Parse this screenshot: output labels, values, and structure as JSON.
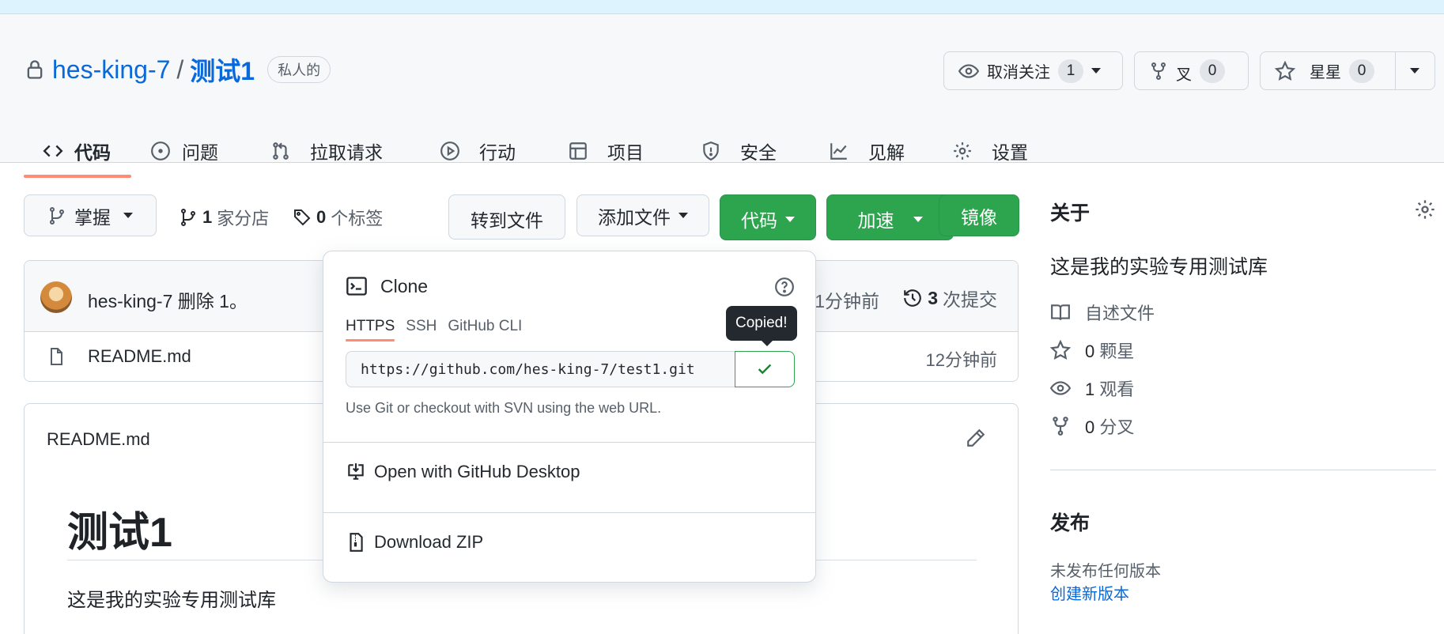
{
  "repo": {
    "owner": "hes-king-7",
    "separator": "/",
    "name": "测试1",
    "visibility": "私人的"
  },
  "header_actions": {
    "watch": {
      "label": "取消关注",
      "count": "1"
    },
    "fork": {
      "label": "叉",
      "count": "0"
    },
    "star": {
      "label": "星星",
      "count": "0"
    }
  },
  "tabs": [
    {
      "label": "代码",
      "icon": "code-icon",
      "active": true
    },
    {
      "label": "问题",
      "icon": "issue-icon"
    },
    {
      "label": "拉取请求",
      "icon": "pull-request-icon"
    },
    {
      "label": "行动",
      "icon": "play-icon"
    },
    {
      "label": "项目",
      "icon": "table-icon"
    },
    {
      "label": "安全",
      "icon": "shield-icon"
    },
    {
      "label": "见解",
      "icon": "graph-icon"
    },
    {
      "label": "设置",
      "icon": "gear-icon"
    }
  ],
  "toolbar": {
    "branch": "掌握",
    "branches_count": "1",
    "branches_label": "家分店",
    "tags_count": "0",
    "tags_label": "个标签",
    "goto_file": "转到文件",
    "add_file": "添加文件",
    "code": "代码",
    "speedup": "加速",
    "mirror": "镜像"
  },
  "commit": {
    "author": "hes-king-7",
    "message": "删除 1。",
    "time": "1分钟前",
    "count": "3",
    "count_label": "次提交"
  },
  "files": [
    {
      "name": "README.md",
      "time": "12分钟前"
    }
  ],
  "readme": {
    "filename": "README.md",
    "heading": "测试1",
    "body": "这是我的实验专用测试库"
  },
  "about": {
    "title": "关于",
    "description": "这是我的实验专用测试库",
    "readme_link": "自述文件",
    "stars_count": "0",
    "stars_label": "颗星",
    "watchers_count": "1",
    "watchers_label": "观看",
    "forks_count": "0",
    "forks_label": "分叉"
  },
  "releases": {
    "title": "发布",
    "empty": "未发布任何版本",
    "create": "创建新版本"
  },
  "clone_popover": {
    "title": "Clone",
    "tabs": [
      "HTTPS",
      "SSH",
      "GitHub CLI"
    ],
    "url": "https://github.com/hes-king-7/test1.git",
    "hint": "Use Git or checkout with SVN using the web URL.",
    "tooltip": "Copied!",
    "open_desktop": "Open with GitHub Desktop",
    "download_zip": "Download ZIP"
  },
  "colors": {
    "accent": "#0969da",
    "green": "#2da44e",
    "tab_underline": "#fd8c73"
  }
}
